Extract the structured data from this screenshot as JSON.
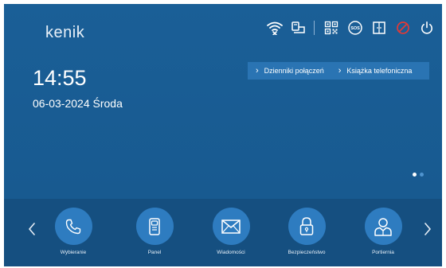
{
  "brand": {
    "logo_text": "kenik"
  },
  "status_icons": [
    "wifi-off-icon",
    "monitor-icon",
    "qr-code-icon",
    "sos-icon",
    "door-icon",
    "do-not-disturb-icon",
    "power-icon"
  ],
  "sos_label": "SOS",
  "time": "14:55",
  "date": "06-03-2024 Środa",
  "links": [
    {
      "label": "Dzienniki połączeń"
    },
    {
      "label": "Książka telefoniczna"
    }
  ],
  "page_indicator": {
    "count": 2,
    "active": 1
  },
  "apps": [
    {
      "label": "Wybieranie",
      "icon": "phone-icon"
    },
    {
      "label": "Panel",
      "icon": "door-panel-icon"
    },
    {
      "label": "Wiadomości",
      "icon": "envelope-icon"
    },
    {
      "label": "Bezpieczeństwo",
      "icon": "lock-icon"
    },
    {
      "label": "Portiernia",
      "icon": "concierge-icon"
    }
  ],
  "colors": {
    "background": "#175a8f",
    "dock": "#154f80",
    "app_circle": "#2e7cc0",
    "links_bar": "#2a74b3",
    "dnd_red": "#e53935"
  }
}
